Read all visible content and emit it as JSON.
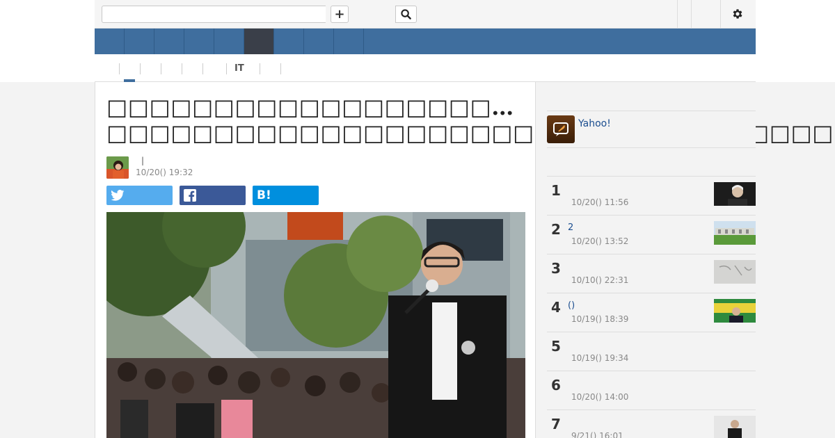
{
  "header": {
    "search_value": "",
    "search_placeholder": "",
    "add_label": "+"
  },
  "subnav": {
    "items": [
      "",
      "",
      "",
      "",
      "",
      "IT",
      "",
      ""
    ]
  },
  "article": {
    "headline": "□□□□□□□□□□□□□□□□□□…□□□□□□□□□□□□□□□□□□□□□□□□□□□□□□□□□□",
    "author_separator": "|",
    "date": "10/20() 19:32",
    "share": {
      "twitter_icon": "twitter-bird-icon",
      "facebook_icon": "facebook-f-icon",
      "hatena_label": "B!"
    }
  },
  "sidebar": {
    "promo_label": "Yahoo!",
    "ranking": [
      {
        "rank": "1",
        "title": "",
        "date": "10/20() 11:56"
      },
      {
        "rank": "2",
        "title": "2",
        "date": "10/20() 13:52"
      },
      {
        "rank": "3",
        "title": "",
        "date": "10/10() 22:31"
      },
      {
        "rank": "4",
        "title": "()",
        "date": "10/19() 18:39"
      },
      {
        "rank": "5",
        "title": "",
        "date": "10/19() 19:34"
      },
      {
        "rank": "6",
        "title": "",
        "date": "10/20() 14:00"
      },
      {
        "rank": "7",
        "title": "",
        "date": "9/21() 16:01"
      }
    ]
  },
  "colors": {
    "nav_bar": "#3f6e9e",
    "nav_active": "#3a3f49",
    "twitter": "#55acee",
    "facebook": "#3b5998",
    "hatena": "#008fde",
    "link": "#1a4d8f"
  }
}
